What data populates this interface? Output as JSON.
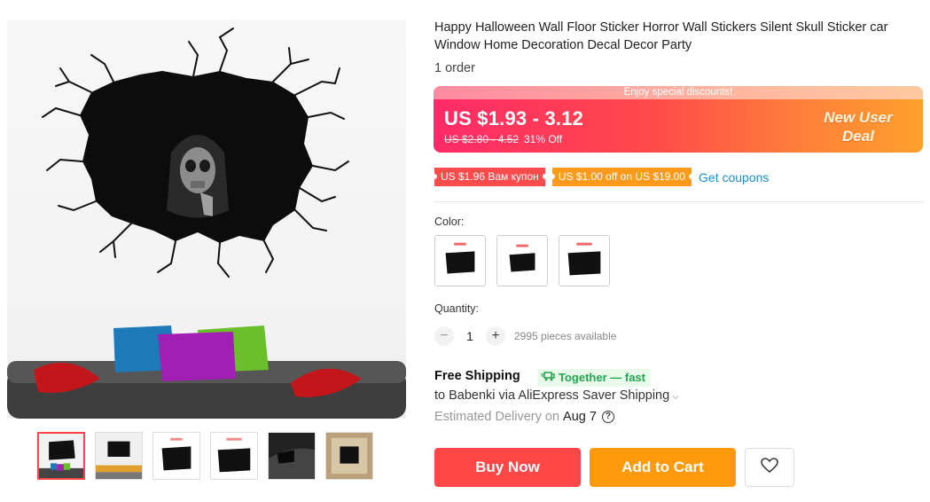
{
  "product": {
    "title": "Happy Halloween Wall Floor Sticker Horror Wall Stickers Silent Skull Sticker car Window Home Decoration Decal Decor Party",
    "orders": "1 order"
  },
  "gallery": {
    "main_image": "skull-wall-sticker-photo",
    "thumbnails": [
      "thumb-1",
      "thumb-2",
      "thumb-3",
      "thumb-4",
      "thumb-5",
      "thumb-6"
    ]
  },
  "price": {
    "banner_text": "Enjoy special discounts!",
    "current": "US $1.93 - 3.12",
    "original": "US $2.80 - 4.52",
    "discount": "31% Off",
    "promo": "New User Deal"
  },
  "coupons": {
    "coupon1": "US $1.96 Вам купон",
    "coupon2": "US $1.00 off on US $19.00",
    "get_label": "Get coupons"
  },
  "color": {
    "label": "Color:",
    "options": [
      "color-1",
      "color-2",
      "color-3"
    ]
  },
  "quantity": {
    "label": "Quantity:",
    "minus": "−",
    "value": "1",
    "plus": "+",
    "available": "2995 pieces available"
  },
  "shipping": {
    "title": "Free Shipping",
    "badge": "Together — fast",
    "line": "to Babenki via AliExpress Saver Shipping",
    "delivery_label": "Estimated Delivery on",
    "delivery_date": "Aug 7",
    "help_icon": "?"
  },
  "actions": {
    "buy_now": "Buy Now",
    "add_to_cart": "Add to Cart"
  },
  "colors": {
    "accent": "#ff4747",
    "cart": "#ff9a0d",
    "link": "#1a8fd1",
    "green": "#1fa84f"
  }
}
